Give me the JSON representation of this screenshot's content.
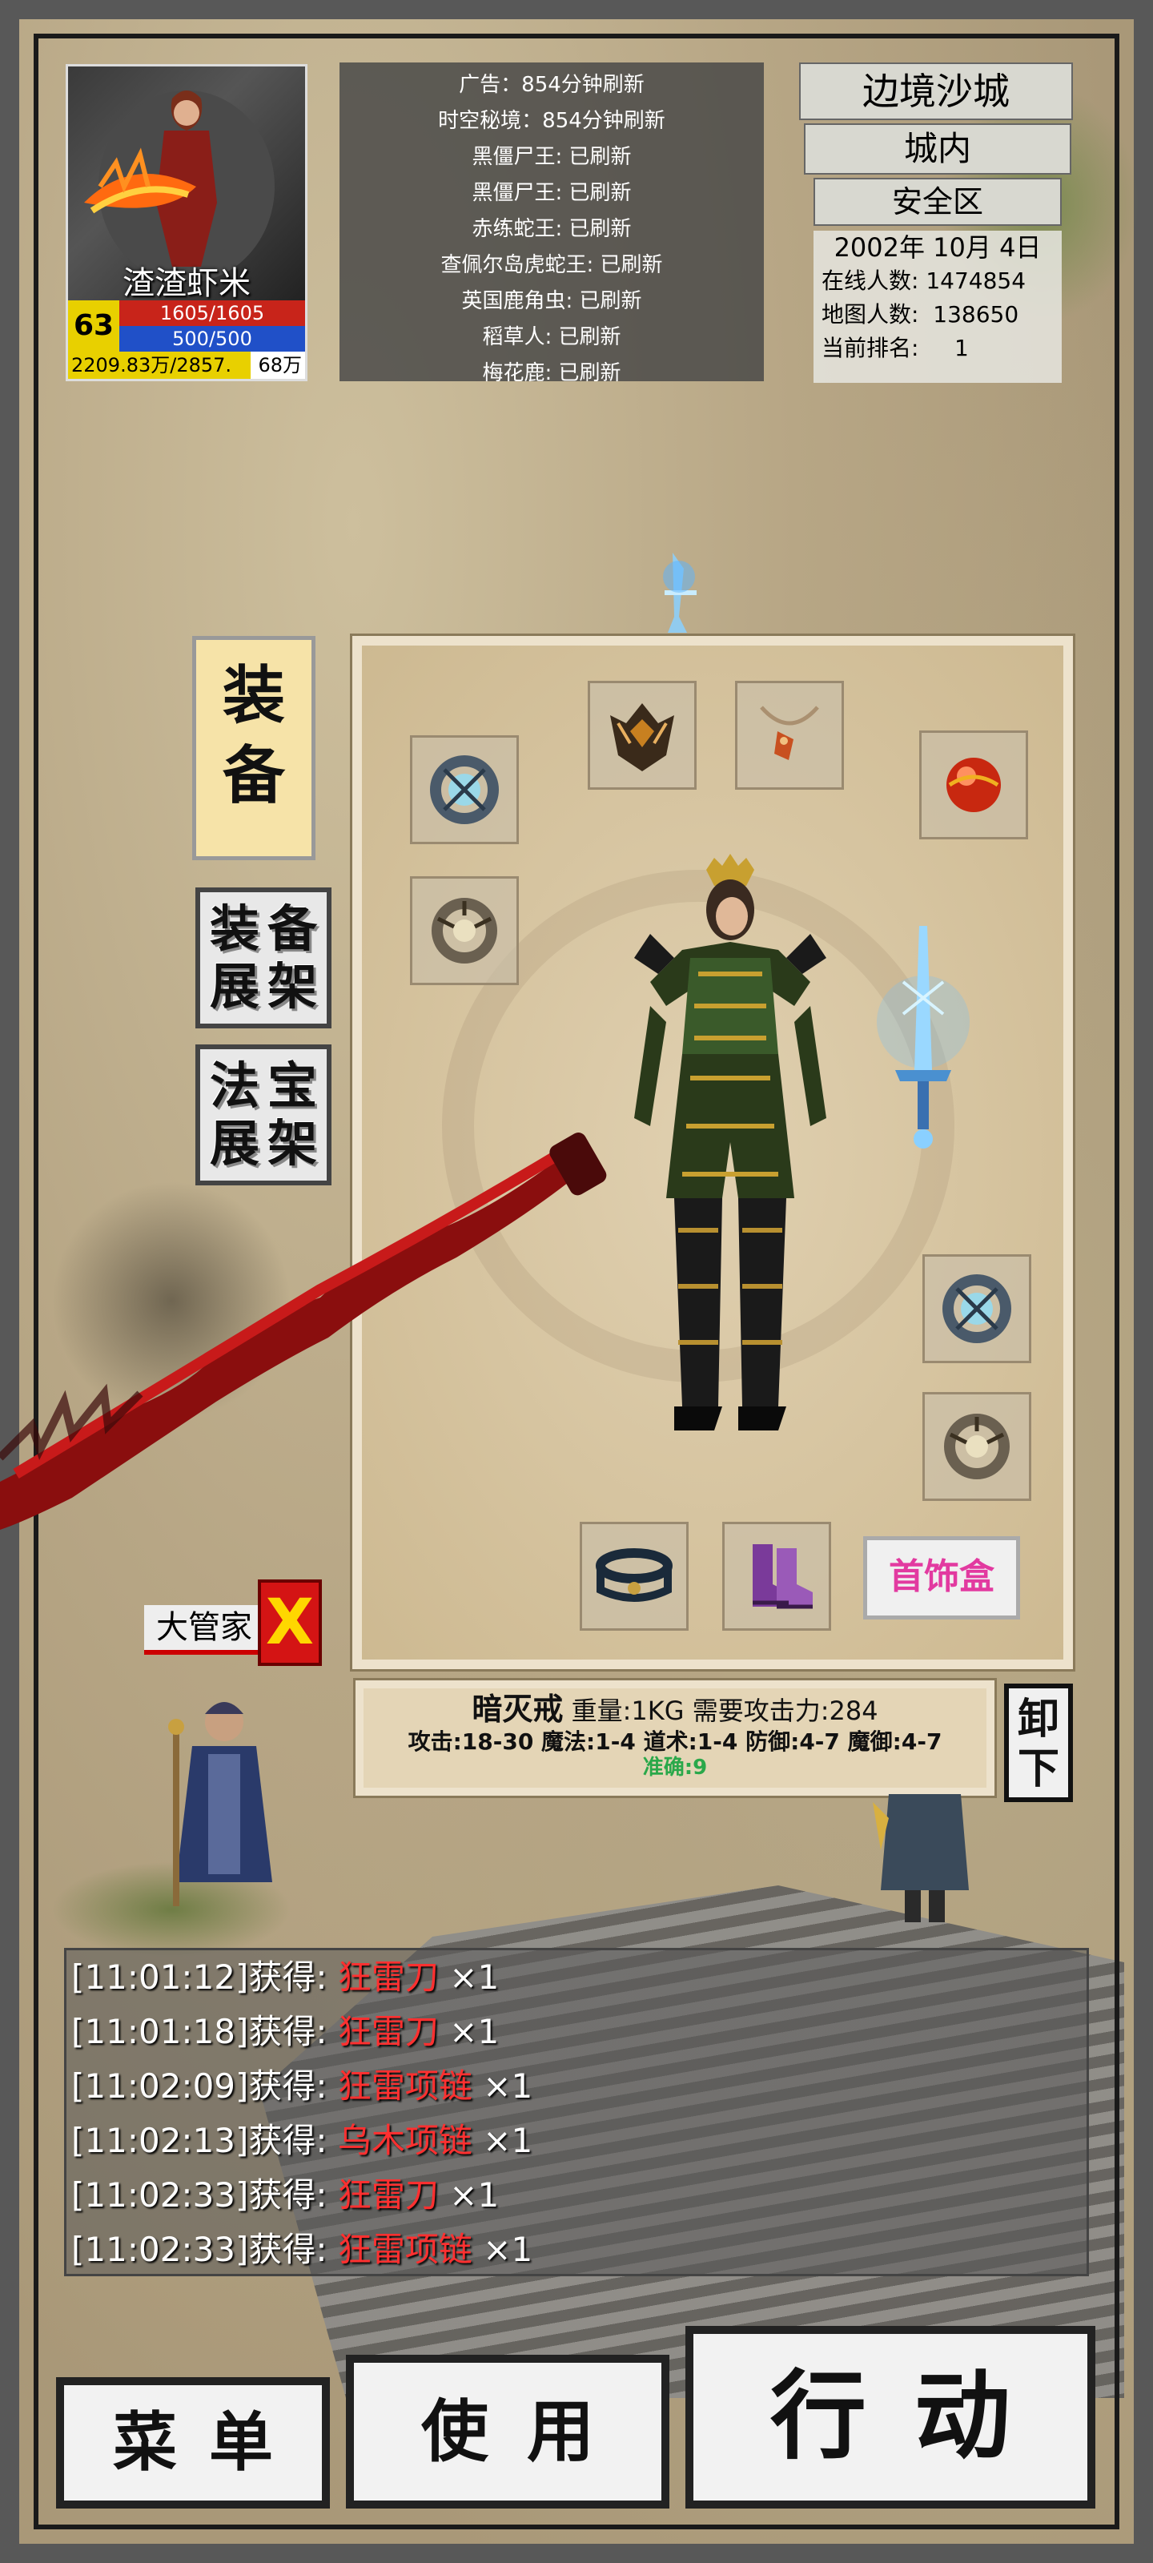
{
  "character": {
    "name": "渣渣虾米",
    "level": "63",
    "hp": "1605/1605",
    "mp": "500/500",
    "exp_text": "2209.83万/2857.",
    "exp_unit": "68万",
    "exp_fraction": 0.77
  },
  "boss_list": [
    "广告：854分钟刷新",
    "时空秘境：854分钟刷新",
    "黑僵尸王: 已刷新",
    "黑僵尸王: 已刷新",
    "赤练蛇王: 已刷新",
    "查佩尔岛虎蛇王: 已刷新",
    "英国鹿角虫: 已刷新",
    "稻草人: 已刷新",
    "梅花鹿: 已刷新"
  ],
  "location": {
    "city": "边境沙城",
    "area": "城内",
    "zone": "安全区",
    "date": "2002年 10月 4日",
    "online_label": "在线人数:",
    "online_value": "1474854",
    "map_label": "地图人数:",
    "map_value": "138650",
    "rank_label": "当前排名:",
    "rank_value": "1"
  },
  "side_tabs": {
    "equip_line1": "装",
    "equip_line2": "备",
    "equip_display": [
      "装",
      "备",
      "展",
      "架"
    ],
    "treasure_display": [
      "法",
      "宝",
      "展",
      "架"
    ]
  },
  "equipment": {
    "accessory_box_label": "首饰盒",
    "slot_icons": [
      "bracelet-icon",
      "helmet-icon",
      "necklace-icon",
      "orb-icon",
      "ring-icon",
      "bracelet-icon",
      "ring-icon",
      "belt-icon",
      "boots-icon"
    ]
  },
  "item": {
    "name": "暗灭戒",
    "line1_rest": " 重量:1KG 需要攻击力:284",
    "line2": "攻击:18-30 魔法:1-4 道术:1-4 防御:4-7 魔御:4-7",
    "line3": "准确:9",
    "unequip_label_1": "卸",
    "unequip_label_2": "下"
  },
  "npc": {
    "name": "大管家",
    "close_label": "X"
  },
  "log": [
    {
      "time": "[11:01:12]获得: ",
      "item": "狂雷刀",
      "qty": " ×1"
    },
    {
      "time": "[11:01:18]获得: ",
      "item": "狂雷刀",
      "qty": " ×1"
    },
    {
      "time": "[11:02:09]获得: ",
      "item": "狂雷项链",
      "qty": " ×1"
    },
    {
      "time": "[11:02:13]获得: ",
      "item": "乌木项链",
      "qty": " ×1"
    },
    {
      "time": "[11:02:33]获得: ",
      "item": "狂雷刀",
      "qty": " ×1"
    },
    {
      "time": "[11:02:33]获得: ",
      "item": "狂雷项链",
      "qty": " ×1"
    }
  ],
  "buttons": {
    "menu": "菜单",
    "use": "使用",
    "action": "行动"
  },
  "colors": {
    "hp_bar": "#c8241a",
    "mp_bar": "#2050c8",
    "level_badge": "#e8d000",
    "log_item": "#ff3030",
    "accessory_text": "#e23aa0",
    "accuracy_text": "#2aa84a"
  }
}
